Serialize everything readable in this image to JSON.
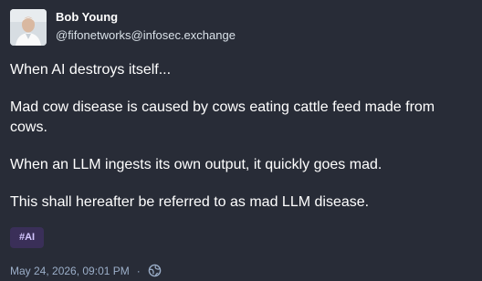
{
  "post": {
    "author": {
      "display_name": "Bob Young",
      "handle": "@fifonetworks@infosec.exchange"
    },
    "paragraphs": [
      "When AI destroys itself...",
      "Mad cow disease is caused by cows eating cattle feed made from cows.",
      "When an LLM ingests its own output, it quickly goes mad.",
      "This shall hereafter be referred to as mad LLM disease."
    ],
    "hashtag": "#AI",
    "timestamp": "May 24, 2026, 09:01 PM",
    "separator": "·",
    "visibility_icon": "globe-icon"
  }
}
